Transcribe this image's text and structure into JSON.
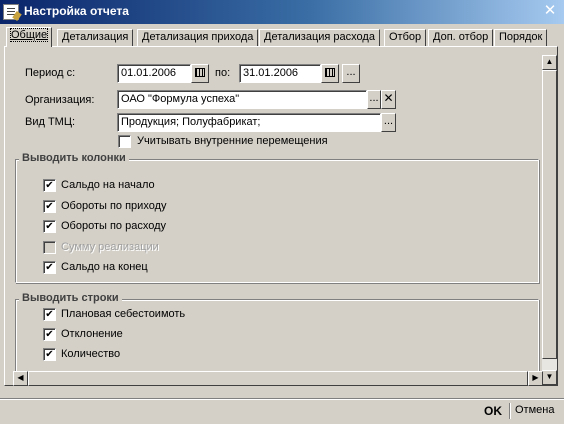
{
  "window": {
    "title": "Настройка отчета",
    "close_glyph": "✕"
  },
  "tabs": [
    {
      "label": "Общие"
    },
    {
      "label": "Детализация"
    },
    {
      "label": "Детализация прихода"
    },
    {
      "label": "Детализация расхода"
    },
    {
      "label": "Отбор"
    },
    {
      "label": "Доп. отбор"
    },
    {
      "label": "Порядок"
    }
  ],
  "period": {
    "label": "Период с:",
    "from_value": "01.01.2006",
    "to_label": "по:",
    "to_value": "31.01.2006",
    "more_glyph": "..."
  },
  "organization": {
    "label": "Организация:",
    "value": "ОАО \"Формула успеха\"",
    "select_glyph": "...",
    "clear_glyph": "✕"
  },
  "tmc": {
    "label": "Вид ТМЦ:",
    "value": "Продукция; Полуфабрикат;",
    "select_glyph": "..."
  },
  "internal_moves": {
    "label": "Учитывать внутренние перемещения",
    "checked": false
  },
  "columns_group": {
    "title": "Выводить колонки",
    "items": [
      {
        "label": "Сальдо на начало",
        "checked": true,
        "enabled": true
      },
      {
        "label": "Обороты по приходу",
        "checked": true,
        "enabled": true
      },
      {
        "label": "Обороты по расходу",
        "checked": true,
        "enabled": true
      },
      {
        "label": "Сумму реализации",
        "checked": false,
        "enabled": false
      },
      {
        "label": "Сальдо на конец",
        "checked": true,
        "enabled": true
      }
    ]
  },
  "rows_group": {
    "title": "Выводить строки",
    "items": [
      {
        "label": "Плановая себестоимоть",
        "checked": true
      },
      {
        "label": "Отклонение",
        "checked": true
      },
      {
        "label": "Количество",
        "checked": true
      }
    ]
  },
  "footer": {
    "ok_label": "OK",
    "cancel_label": "Отмена"
  },
  "check_glyph": "✔",
  "scroll_glyphs": {
    "up": "▲",
    "down": "▼",
    "left": "◀",
    "right": "▶"
  }
}
